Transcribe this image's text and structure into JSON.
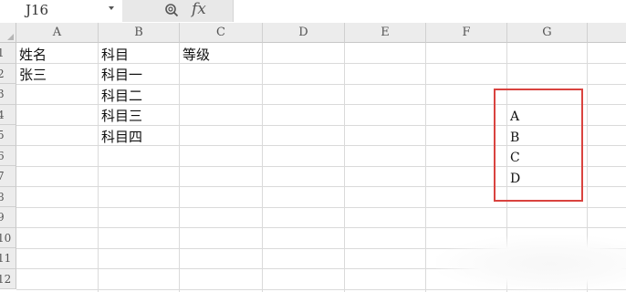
{
  "formula_bar": {
    "name_box": "J16",
    "zoom_icon": "zoom-icon",
    "fx_label": "fx",
    "formula_value": ""
  },
  "columns": [
    "A",
    "B",
    "C",
    "D",
    "E",
    "F",
    "G"
  ],
  "rows": [
    "1",
    "2",
    "3",
    "4",
    "5",
    "6",
    "7",
    "8",
    "9",
    "10",
    "11",
    "12"
  ],
  "cells": {
    "A1": "姓名",
    "B1": "科目",
    "C1": "等级",
    "A2": "张三",
    "B2": "科目一",
    "B3": "科目二",
    "B4": "科目三",
    "B5": "科目四",
    "G4": "A",
    "G5": "B",
    "G6": "C",
    "G7": "D"
  },
  "colors": {
    "highlight_border": "#d9433f",
    "header_bg": "#ececec",
    "gridline": "#dadada"
  }
}
